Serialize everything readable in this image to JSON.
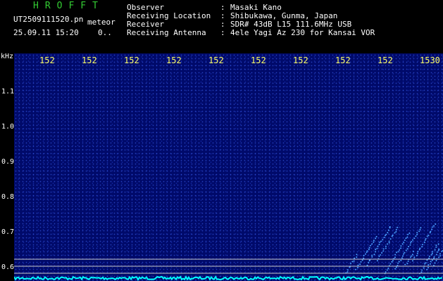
{
  "header": {
    "brand": "HROFFT",
    "filename": "UT2509111520.pn",
    "mode": "meteor",
    "datetime": "25.09.11 15:20",
    "value": "0..",
    "info": [
      {
        "label": "Observer",
        "value": "Masaki Kano"
      },
      {
        "label": "Receiving Location",
        "value": "Shibukawa, Gunma, Japan"
      },
      {
        "label": "Receiver",
        "value": "SDR# 43dB L15 111.6MHz USB"
      },
      {
        "label": "Receiving Antenna",
        "value": "4ele Yagi Az 230 for Kansai VOR"
      }
    ],
    "separator": ":"
  },
  "axis": {
    "unit": "kHz",
    "y_ticks": [
      "1.1",
      "1.0",
      "0.9",
      "0.8",
      "0.7",
      "0.6"
    ],
    "x_ticks": [
      "152",
      "152",
      "152",
      "152",
      "152",
      "152",
      "152",
      "152",
      "152",
      "1530"
    ]
  },
  "colors": {
    "background": "#000a6a",
    "signal": "#4aa0ff",
    "baseline": "#00ffff",
    "gridline": "#c8c8c8",
    "brand": "#33cc33",
    "tick_label": "#ffff66"
  }
}
